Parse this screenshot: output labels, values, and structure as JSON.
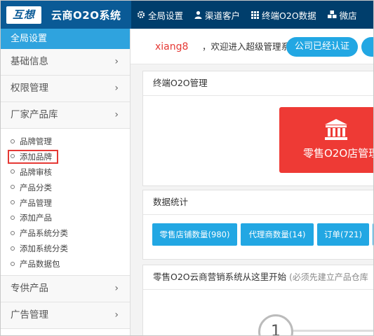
{
  "header": {
    "logo_badge": "互想",
    "title": "云商O2O系统",
    "nav": [
      {
        "label": "全局设置",
        "icon": "gear-icon"
      },
      {
        "label": "渠道客户",
        "icon": "user-icon"
      },
      {
        "label": "终端O2O数据",
        "icon": "grid-icon"
      },
      {
        "label": "微店",
        "icon": "cubes-icon"
      }
    ]
  },
  "sidebar": {
    "heading": "全局设置",
    "groups_top": [
      {
        "label": "基础信息"
      },
      {
        "label": "权限管理"
      },
      {
        "label": "厂家产品库"
      }
    ],
    "submenu": [
      {
        "label": "品牌管理"
      },
      {
        "label": "添加品牌",
        "highlighted": true
      },
      {
        "label": "品牌审核"
      },
      {
        "label": "产品分类"
      },
      {
        "label": "产品管理"
      },
      {
        "label": "添加产品"
      },
      {
        "label": "产品系统分类"
      },
      {
        "label": "添加系统分类"
      },
      {
        "label": "产品数据包"
      }
    ],
    "groups_bottom": [
      {
        "label": "专供产品"
      },
      {
        "label": "广告管理"
      }
    ]
  },
  "welcome": {
    "user": "xiang8",
    "text": "，欢迎进入超级管理系统",
    "certified_button": "公司已经认证",
    "accent": "#e53935"
  },
  "terminal_panel": {
    "title": "终端O2O管理",
    "tile_label": "零售O2O店管理",
    "tile_color": "#ee3a35",
    "tile_icon": "bank-icon"
  },
  "stats_panel": {
    "title": "数据统计",
    "buttons": [
      {
        "label": "零售店铺数量(980)"
      },
      {
        "label": "代理商数量(14)"
      },
      {
        "label": "订单(721)"
      }
    ],
    "color": "#22a7e3"
  },
  "start_panel": {
    "title": "零售O2O云商营销系统从这里开始",
    "hint": "(必须先建立产品仓库",
    "step_number": "1"
  }
}
